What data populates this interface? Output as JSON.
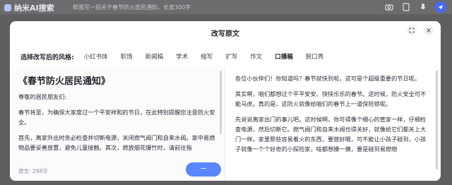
{
  "app": {
    "name": "纳米AI搜索"
  },
  "search": {
    "hint": "帮我写一段关于春节防火居民通知，长度300字"
  },
  "modal": {
    "title": "改写原文"
  },
  "styles": {
    "label": "选择改写后的风格:",
    "items": [
      "小红书体",
      "职场",
      "新闻稿",
      "学术",
      "缩写",
      "扩写",
      "作文",
      "口播稿",
      "脱口秀"
    ],
    "active_index": 7
  },
  "original": {
    "title": "《春节防火居民通知》",
    "paragraphs": [
      "尊敬的居民朋友们:",
      "春节将至，为确保大家度过一个平安祥和的节日，在此特别提醒您注意防火安全。",
      "首先，离家外出时务必检查并切断电源，关闭燃气阀门和自来水阀。家中易燃物品要妥善放置，避免儿童接触。其次，燃放烟花爆竹时，请前往指"
    ],
    "word_count": "原文: 298字",
    "rewrite_button": "一"
  },
  "rewritten": {
    "paragraphs": [
      "各位小伙伴们！你知道吗？春节就快到啦，这可是个超级重要的节日呢。",
      "其实啊，咱们都想过个平平安安、快快乐乐的春节。这时候，防火安全可不能马虎。真的是，这防火就像给咱们的春节上一道保险锁呢。",
      "先说说离家出门的事儿吧。这时候啊，你可得像个细心的管家一样，仔细检查电源，然后切断它。燃气阀门和自来水阀也得关好，就像给它们都关上大门一样。家里那些容易着火的东西，要放好哦，可不能让小孩子碰到，小孩子就像一个个好奇的小探险家，啥都想摸一摸，要是碰到易燃物"
    ]
  }
}
